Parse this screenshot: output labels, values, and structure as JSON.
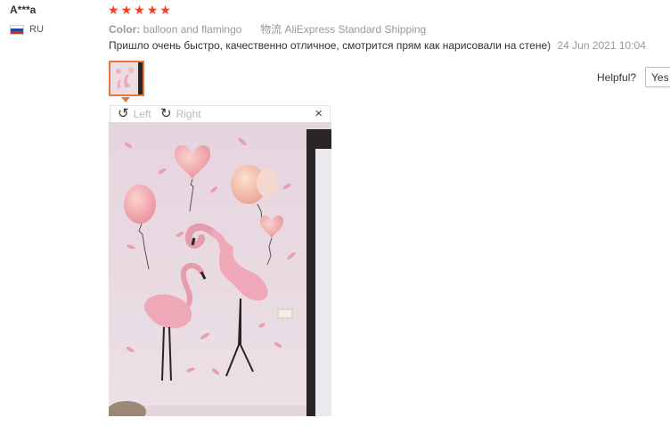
{
  "review": {
    "user_name": "A***a",
    "country_code": "RU",
    "rating": 5,
    "star_glyph": "★",
    "star_color": "#ff3a1f",
    "color_label": "Color:",
    "color_value": "balloon and flamingo",
    "shipping_label": "物流",
    "shipping_value": "AliExpress Standard Shipping",
    "text": "Пришло очень быстро, качественно отличное, смотрится прям как нарисовали на стене)",
    "date": "24 Jun 2021 10:04",
    "helpful_label": "Helpful?",
    "yes_label": "Yes"
  },
  "viewer": {
    "rotate_left_label": "Left",
    "rotate_right_label": "Right",
    "close_glyph": "×",
    "rotate_left_glyph": "↺",
    "rotate_right_glyph": "↻"
  },
  "colors": {
    "accent": "#e6773a",
    "muted_text": "#999999",
    "wall": "#e8dae2"
  },
  "icons": [
    "russia-flag-icon",
    "star-icon",
    "rotate-left-icon",
    "rotate-right-icon",
    "close-icon"
  ]
}
